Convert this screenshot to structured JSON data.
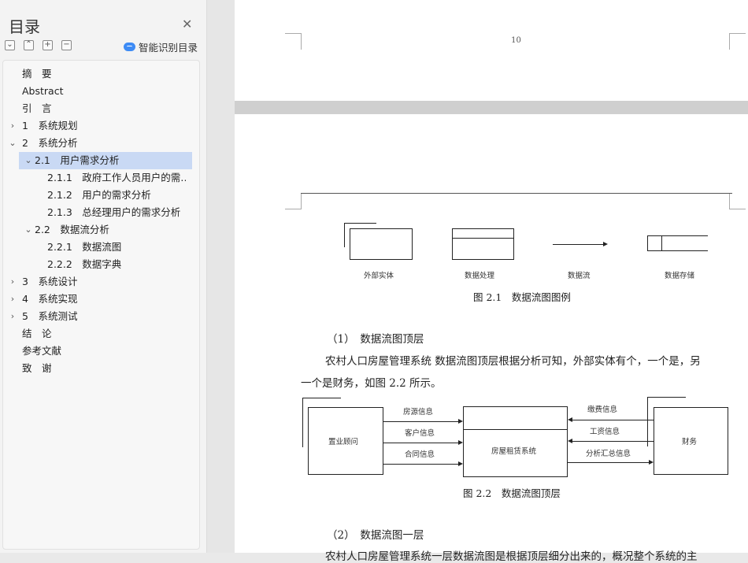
{
  "sidebar": {
    "title": "目录",
    "smart_toc_label": "智能识别目录",
    "toolbar": [
      "collapse-all",
      "expand-all",
      "add-heading",
      "remove-heading"
    ],
    "items": [
      {
        "label": "摘　要"
      },
      {
        "label": "Abstract"
      },
      {
        "label": "引　言"
      },
      {
        "label": "1　系统规划"
      },
      {
        "label": "2　系统分析"
      },
      {
        "label": "2.1　用户需求分析"
      },
      {
        "label": "2.1.1　政府工作人员用户的需…"
      },
      {
        "label": "2.1.2　用户的需求分析"
      },
      {
        "label": "2.1.3　总经理用户的需求分析"
      },
      {
        "label": "2.2　数据流分析"
      },
      {
        "label": "2.2.1　数据流图"
      },
      {
        "label": "2.2.2　数据字典"
      },
      {
        "label": "3　系统设计"
      },
      {
        "label": "4　系统实现"
      },
      {
        "label": "5　系统测试"
      },
      {
        "label": "结　论"
      },
      {
        "label": "参考文献"
      },
      {
        "label": "致　谢"
      }
    ]
  },
  "document": {
    "page_number": "10",
    "legend": {
      "external_entity": "外部实体",
      "process": "数据处理",
      "flow": "数据流",
      "store": "数据存储",
      "caption": "图 2.1　数据流图图例"
    },
    "section1_heading": "（1）　数据流图顶层",
    "para1_line1": "农村人口房屋管理系统 数据流图顶层根据分析可知，外部实体有个，一个是，另",
    "para1_line2": "一个是财务，如图 2.2 所示。",
    "dfd": {
      "left_entity": "置业顾问",
      "center_process": "房屋租赁系统",
      "right_entity": "财务",
      "left_flows": [
        "房源信息",
        "客户信息",
        "合同信息"
      ],
      "right_flows": [
        "缴费信息",
        "工资信息",
        "分析汇总信息"
      ],
      "caption": "图 2.2　数据流图顶层"
    },
    "section2_heading": "（2）　数据流图一层",
    "para2_partial": "农村人口房屋管理系统一层数据流图是根据顶层细分出来的，概况整个系统的主"
  }
}
